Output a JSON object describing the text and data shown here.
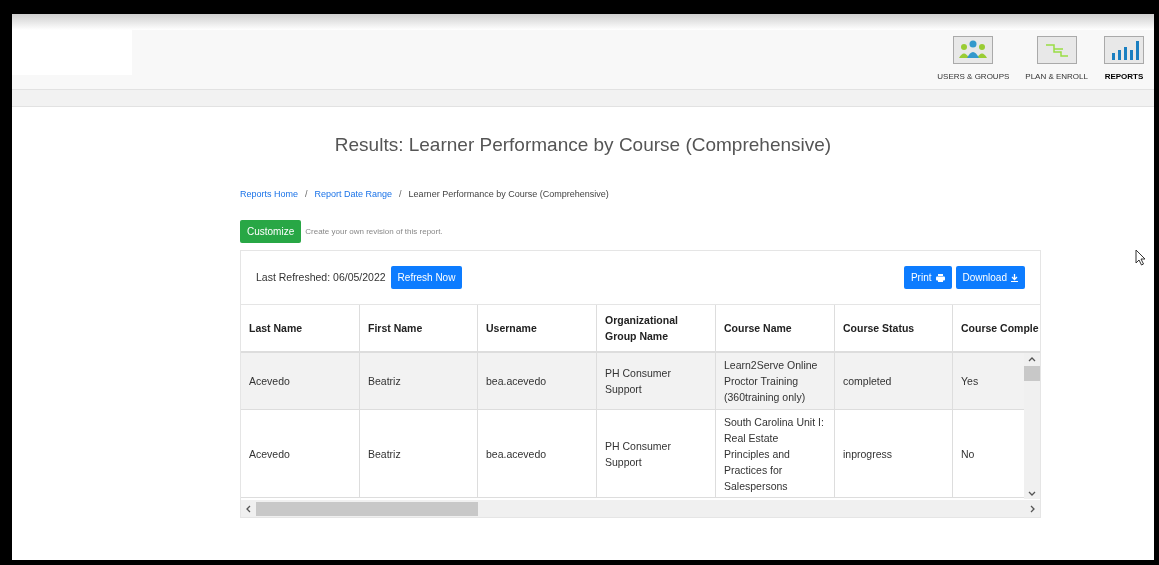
{
  "nav": [
    {
      "label": "USERS & GROUPS",
      "selected": false
    },
    {
      "label": "PLAN & ENROLL",
      "selected": false
    },
    {
      "label": "REPORTS",
      "selected": true
    }
  ],
  "title": "Results: Learner Performance by Course (Comprehensive)",
  "breadcrumb": [
    {
      "kind": "link",
      "label": "Reports Home"
    },
    {
      "kind": "separator",
      "label": "/"
    },
    {
      "kind": "link",
      "label": "Report Date Range"
    },
    {
      "kind": "separator",
      "label": "/"
    },
    {
      "kind": "current",
      "label": "Learner Performance by Course (Comprehensive)"
    }
  ],
  "customize": {
    "button": "Customize",
    "hint": "Create your own revision of this report."
  },
  "toolbar": {
    "last_refreshed": "Last Refreshed: 06/05/2022",
    "refresh": "Refresh Now",
    "print": "Print",
    "download": "Download"
  },
  "table": {
    "columns": [
      "Last Name",
      "First Name",
      "Username",
      "Organizational Group Name",
      "Course Name",
      "Course Status",
      "Course Comple"
    ],
    "rows": [
      {
        "selected": true,
        "cells": [
          "Acevedo",
          "Beatriz",
          "bea.acevedo",
          "PH Consumer Support",
          "Learn2Serve Online Proctor Training (360training only)",
          "completed",
          "Yes"
        ]
      },
      {
        "selected": false,
        "cells": [
          "Acevedo",
          "Beatriz",
          "bea.acevedo",
          "PH Consumer Support",
          "South Carolina Unit I: Real Estate Principles and Practices for Salespersons",
          "inprogress",
          "No"
        ]
      }
    ]
  }
}
